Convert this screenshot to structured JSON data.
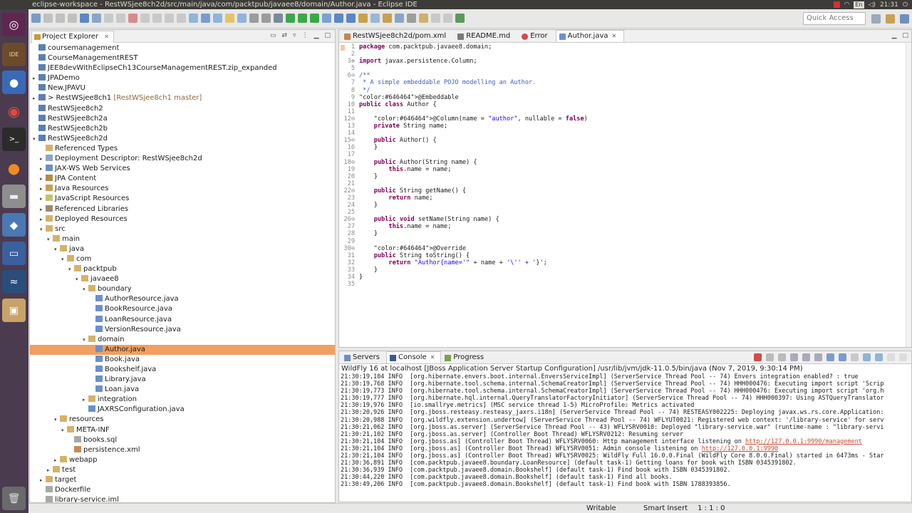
{
  "window": {
    "title": "eclipse-workspace - RestWSjee8ch2d/src/main/java/com/packtpub/javaee8/domain/Author.java - Eclipse IDE",
    "lang": "En",
    "time": "21:31"
  },
  "toolbar": {
    "quick_access_placeholder": "Quick Access"
  },
  "project_explorer": {
    "title": "Project Explorer",
    "close": "✕",
    "items": [
      {
        "label": "coursemanagement",
        "indent": 0,
        "arrow": "",
        "icon": "project-icon"
      },
      {
        "label": "CourseManagementREST",
        "indent": 0,
        "arrow": "",
        "icon": "project-icon"
      },
      {
        "label": "JEE8devWithEclipseCh13CourseManagementREST.zip_expanded",
        "indent": 0,
        "arrow": "",
        "icon": "project-icon"
      },
      {
        "label": "JPADemo",
        "indent": 0,
        "arrow": "▸",
        "icon": "project-icon"
      },
      {
        "label": "New.JPAVU",
        "indent": 0,
        "arrow": "",
        "icon": "project-icon"
      },
      {
        "label": "> RestWSjee8ch1",
        "extra": "[RestWSjee8ch1 master]",
        "indent": 0,
        "arrow": "▸",
        "icon": "project-icon"
      },
      {
        "label": "RestWSjee8ch2",
        "indent": 0,
        "arrow": "",
        "icon": "project-icon"
      },
      {
        "label": "RestWSjee8ch2a",
        "indent": 0,
        "arrow": "",
        "icon": "project-icon"
      },
      {
        "label": "RestWSjee8ch2b",
        "indent": 0,
        "arrow": "",
        "icon": "project-icon"
      },
      {
        "label": "RestWSjee8ch2d",
        "indent": 0,
        "arrow": "▾",
        "icon": "project-icon"
      },
      {
        "label": "Referenced Types",
        "indent": 1,
        "arrow": "",
        "icon": "folder-icon"
      },
      {
        "label": "Deployment Descriptor: RestWSjee8ch2d",
        "indent": 1,
        "arrow": "▸",
        "icon": "descriptor-icon"
      },
      {
        "label": "JAX-WS Web Services",
        "indent": 1,
        "arrow": "▸",
        "icon": "webservice-icon"
      },
      {
        "label": "JPA Content",
        "indent": 1,
        "arrow": "▸",
        "icon": "jpa-icon"
      },
      {
        "label": "Java Resources",
        "indent": 1,
        "arrow": "▸",
        "icon": "java-resources-icon"
      },
      {
        "label": "JavaScript Resources",
        "indent": 1,
        "arrow": "▸",
        "icon": "js-resources-icon"
      },
      {
        "label": "Referenced Libraries",
        "indent": 1,
        "arrow": "▸",
        "icon": "library-icon"
      },
      {
        "label": "Deployed Resources",
        "indent": 1,
        "arrow": "▸",
        "icon": "folder-icon"
      },
      {
        "label": "src",
        "indent": 1,
        "arrow": "▾",
        "icon": "folder-icon"
      },
      {
        "label": "main",
        "indent": 2,
        "arrow": "▾",
        "icon": "folder-icon"
      },
      {
        "label": "java",
        "indent": 3,
        "arrow": "▾",
        "icon": "folder-icon"
      },
      {
        "label": "com",
        "indent": 4,
        "arrow": "▾",
        "icon": "folder-icon"
      },
      {
        "label": "packtpub",
        "indent": 5,
        "arrow": "▾",
        "icon": "folder-icon"
      },
      {
        "label": "javaee8",
        "indent": 6,
        "arrow": "▾",
        "icon": "folder-icon"
      },
      {
        "label": "boundary",
        "indent": 7,
        "arrow": "▾",
        "icon": "folder-icon"
      },
      {
        "label": "AuthorResource.java",
        "indent": 8,
        "arrow": "",
        "icon": "java-file-icon"
      },
      {
        "label": "BookResource.java",
        "indent": 8,
        "arrow": "",
        "icon": "java-file-icon"
      },
      {
        "label": "LoanResource.java",
        "indent": 8,
        "arrow": "",
        "icon": "java-file-icon"
      },
      {
        "label": "VersionResource.java",
        "indent": 8,
        "arrow": "",
        "icon": "java-file-icon"
      },
      {
        "label": "domain",
        "indent": 7,
        "arrow": "▾",
        "icon": "folder-icon"
      },
      {
        "label": "Author.java",
        "indent": 8,
        "arrow": "",
        "icon": "java-file-icon",
        "selected": true
      },
      {
        "label": "Book.java",
        "indent": 8,
        "arrow": "",
        "icon": "java-file-icon"
      },
      {
        "label": "Bookshelf.java",
        "indent": 8,
        "arrow": "",
        "icon": "java-file-icon"
      },
      {
        "label": "Library.java",
        "indent": 8,
        "arrow": "",
        "icon": "java-file-icon"
      },
      {
        "label": "Loan.java",
        "indent": 8,
        "arrow": "",
        "icon": "java-file-icon"
      },
      {
        "label": "integration",
        "indent": 7,
        "arrow": "▸",
        "icon": "folder-icon"
      },
      {
        "label": "JAXRSConfiguration.java",
        "indent": 7,
        "arrow": "",
        "icon": "java-file-icon"
      },
      {
        "label": "resources",
        "indent": 3,
        "arrow": "▾",
        "icon": "folder-icon"
      },
      {
        "label": "META-INF",
        "indent": 4,
        "arrow": "▾",
        "icon": "folder-icon"
      },
      {
        "label": "books.sql",
        "indent": 5,
        "arrow": "",
        "icon": "file-icon"
      },
      {
        "label": "persistence.xml",
        "indent": 5,
        "arrow": "",
        "icon": "xml-file-icon"
      },
      {
        "label": "webapp",
        "indent": 3,
        "arrow": "▸",
        "icon": "folder-icon"
      },
      {
        "label": "test",
        "indent": 2,
        "arrow": "▸",
        "icon": "folder-icon"
      },
      {
        "label": "target",
        "indent": 1,
        "arrow": "▸",
        "icon": "folder-icon"
      },
      {
        "label": "Dockerfile",
        "indent": 1,
        "arrow": "",
        "icon": "file-icon"
      },
      {
        "label": "library-service.iml",
        "indent": 1,
        "arrow": "",
        "icon": "file-icon"
      }
    ]
  },
  "editor": {
    "tabs": [
      {
        "label": "RestWSjee8ch2d/pom.xml",
        "icon": "maven-icon",
        "active": false
      },
      {
        "label": "README.md",
        "icon": "markdown-icon",
        "active": false
      },
      {
        "label": "Error",
        "icon": "error-icon",
        "active": false
      },
      {
        "label": "Author.java",
        "icon": "java-file-icon",
        "active": true
      }
    ],
    "lines": [
      {
        "n": "1",
        "text": "package com.packtpub.javaee8.domain;"
      },
      {
        "n": "2",
        "text": ""
      },
      {
        "n": "3⊕",
        "text": "import javax.persistence.Column;"
      },
      {
        "n": "5",
        "text": ""
      },
      {
        "n": "6⊖",
        "text": "/**"
      },
      {
        "n": "7",
        "text": " * A simple embeddable POJO modelling an Author."
      },
      {
        "n": "8",
        "text": " */"
      },
      {
        "n": "9",
        "text": "@Embeddable"
      },
      {
        "n": "10",
        "text": "public class Author {"
      },
      {
        "n": "11",
        "text": ""
      },
      {
        "n": "12⊖",
        "text": "    @Column(name = \"author\", nullable = false)"
      },
      {
        "n": "13",
        "text": "    private String name;"
      },
      {
        "n": "14",
        "text": ""
      },
      {
        "n": "15⊖",
        "text": "    public Author() {"
      },
      {
        "n": "16",
        "text": "    }"
      },
      {
        "n": "17",
        "text": ""
      },
      {
        "n": "18⊖",
        "text": "    public Author(String name) {"
      },
      {
        "n": "19",
        "text": "        this.name = name;"
      },
      {
        "n": "20",
        "text": "    }"
      },
      {
        "n": "21",
        "text": ""
      },
      {
        "n": "22⊖",
        "text": "    public String getName() {"
      },
      {
        "n": "23",
        "text": "        return name;"
      },
      {
        "n": "24",
        "text": "    }"
      },
      {
        "n": "25",
        "text": ""
      },
      {
        "n": "26⊖",
        "text": "    public void setName(String name) {"
      },
      {
        "n": "27",
        "text": "        this.name = name;"
      },
      {
        "n": "28",
        "text": "    }"
      },
      {
        "n": "29",
        "text": ""
      },
      {
        "n": "30⊖",
        "text": "    @Override"
      },
      {
        "n": "31",
        "text": "    public String toString() {"
      },
      {
        "n": "32",
        "text": "        return \"Author{name='\" + name + '\\'' + '}';"
      },
      {
        "n": "33",
        "text": "    }"
      },
      {
        "n": "34",
        "text": "}"
      },
      {
        "n": "35",
        "text": ""
      }
    ]
  },
  "console": {
    "tabs": [
      {
        "label": "Servers",
        "icon": "servers-icon",
        "active": false
      },
      {
        "label": "Console",
        "icon": "console-icon",
        "active": true
      },
      {
        "label": "Progress",
        "icon": "progress-icon",
        "active": false
      }
    ],
    "description": "WildFly 16 at localhost [JBoss Application Server Startup Configuration] /usr/lib/jvm/jdk-11.0.5/bin/java (Nov 7, 2019, 9:30:14 PM)",
    "lines": [
      "21:30:19,104 INFO  [org.hibernate.envers.boot.internal.EnversServiceImpl] (ServerService Thread Pool -- 74) Envers integration enabled? : true",
      "21:30:19,768 INFO  [org.hibernate.tool.schema.internal.SchemaCreatorImpl] (ServerService Thread Pool -- 74) HHH000476: Executing import script 'Scrip",
      "21:30:19,773 INFO  [org.hibernate.tool.schema.internal.SchemaCreatorImpl] (ServerService Thread Pool -- 74) HHH000476: Executing import script 'org.h",
      "21:30:19,777 INFO  [org.hibernate.hql.internal.QueryTranslatorFactoryInitiator] (ServerService Thread Pool -- 74) HHH000397: Using ASTQueryTranslator",
      "21:30:19,976 INFO  [io.smallrye.metrics] (MSC service thread 1-5) MicroProfile: Metrics activated",
      "21:30:20,926 INFO  [org.jboss.resteasy.resteasy_jaxrs.i18n] (ServerService Thread Pool -- 74) RESTEASY002225: Deploying javax.ws.rs.core.Application:",
      "21:30:20,988 INFO  [org.wildfly.extension.undertow] (ServerService Thread Pool -- 74) WFLYUT0021: Registered web context: '/library-service' for serv",
      "21:30:21,062 INFO  [org.jboss.as.server] (ServerService Thread Pool -- 43) WFLYSRV0010: Deployed \"library-service.war\" (runtime-name : \"library-servi",
      "21:30:21,102 INFO  [org.jboss.as.server] (Controller Boot Thread) WFLYSRV0212: Resuming server",
      "21:30:21,104 INFO  [org.jboss.as] (Controller Boot Thread) WFLYSRV0060: Http management interface listening on ",
      "21:30:21,104 INFO  [org.jboss.as] (Controller Boot Thread) WFLYSRV0051: Admin console listening on ",
      "21:30:21,104 INFO  [org.jboss.as] (Controller Boot Thread) WFLYSRV0025: WildFly Full 16.0.0.Final (WildFly Core 8.0.0.Final) started in 6473ms - Star",
      "21:30:36,891 INFO  [com.packtpub.javaee8.boundary.LoanResource] (default task-1) Getting loans for book with ISBN 0345391802.",
      "21:30:36,939 INFO  [com.packtpub.javaee8.domain.Bookshelf] (default task-1) Find book with ISBN 0345391802.",
      "21:30:44,220 INFO  [com.packtpub.javaee8.domain.Bookshelf] (default task-1) Find all books.",
      "21:30:49,206 INFO  [com.packtpub.javaee8.domain.Bookshelf] (default task-1) Find book with ISBN 1788393856."
    ],
    "link_mgmt": "http://127.0.0.1:9990/management",
    "link_admin": "http://127.0.0.1:9990"
  },
  "status": {
    "writable": "Writable",
    "insert_mode": "Smart Insert",
    "position": "1 : 1 : 0"
  },
  "colors": {
    "selection": "#f0a060",
    "keyword": "#7f0055",
    "annotation": "#646464",
    "comment": "#3f5fbf",
    "string": "#2a00ff",
    "field": "#0000c0"
  }
}
